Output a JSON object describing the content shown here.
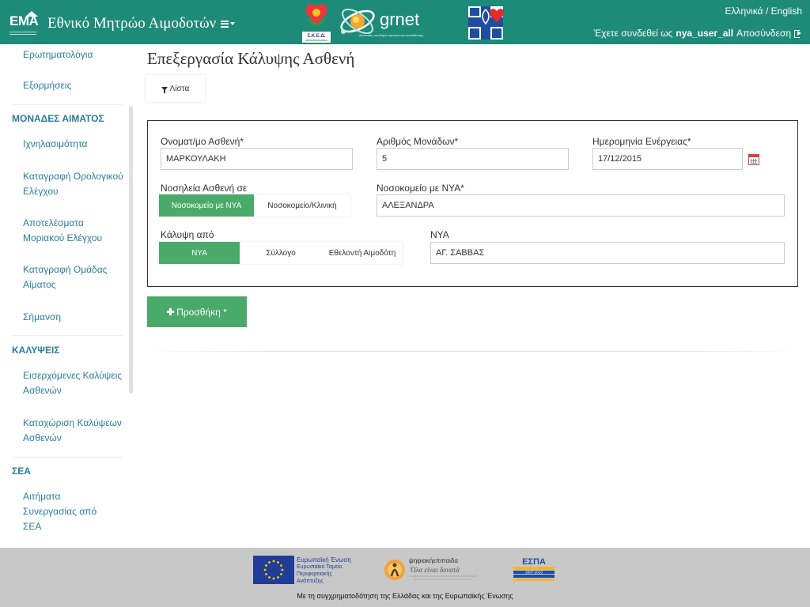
{
  "header": {
    "logo_text": "EMA",
    "title": "Εθνικό Μητρώο Αιμοδοτών",
    "sea_logo_text": "Σ.Κ.Ε.Δ.",
    "grnet_word": "grnet",
    "grnet_tagline": "Δικτυακές υποδομές έρευνας και εκπαίδευσης",
    "lang_greek": "Ελληνικά",
    "lang_sep": "/",
    "lang_english": "English",
    "user_prefix": "Έχετε συνδεθεί ως",
    "username": "nya_user_all",
    "logout_label": "Αποσύνδεση"
  },
  "sidebar": {
    "items": [
      {
        "label": "Ερωτηματολόγια"
      },
      {
        "label": "Εξορμήσεις"
      }
    ],
    "section_blood": "ΜΟΝΑΔΕΣ ΑΙΜΑΤΟΣ",
    "blood_items": [
      {
        "label": "Ιχνηλασιμότητα"
      },
      {
        "label": "Καταγραφή Ορολογικού Ελέγχου"
      },
      {
        "label": "Αποτελέσματα Μοριακού Ελέγχου"
      },
      {
        "label": "Καταγραφή Ομάδας Αίματος"
      },
      {
        "label": "Σήμανση"
      }
    ],
    "section_coverage": "ΚΑΛΥΨΕΙΣ",
    "coverage_items": [
      {
        "label": "Εισερχόμενες Καλύψεις Ασθενών"
      },
      {
        "label": "Καταχώριση Καλύψεων Ασθενών"
      }
    ],
    "section_sea": "ΣΕΑ",
    "sea_items": [
      {
        "label": "Αιτήματα Συνεργασίας από ΣΕΑ"
      }
    ]
  },
  "main": {
    "title": "Επεξεργασία Κάλυψης Ασθενή",
    "list_button": "Λίστα",
    "form": {
      "patient_name_label": "Ονοματ/μο Ασθενή*",
      "patient_name_value": "ΜΑΡΚΟΥΛΑΚΗ",
      "units_label": "Αριθμός Μονάδων*",
      "units_value": "5",
      "date_label": "Ημερομηνία Ενέργειας*",
      "date_value": "17/12/2015",
      "hospitalization_label": "Νοσηλεία Ασθενή σε",
      "hospitalization_options": [
        "Νοσοκομείο με ΝΥΑ",
        "Νοσοκομείο/Κλινική"
      ],
      "hospitalization_selected": 0,
      "hospital_label": "Νοσοκομείο με ΝΥΑ*",
      "hospital_value": "ΑΛΕΞΑΝΔΡΑ",
      "coverage_label": "Κάλυψη από",
      "coverage_options": [
        "ΝΥΑ",
        "Σύλλογο",
        "Εθελοντή Αιμοδότη"
      ],
      "coverage_selected": 0,
      "nya_label": "ΝΥΑ",
      "nya_value": "ΑΓ. ΣΑΒΒΑΣ"
    },
    "add_button": "Προσθήκη *"
  },
  "footer": {
    "eu_line1": "Ευρωπαϊκή Ένωση",
    "eu_line2": "Ευρωπαϊκό Ταμείο",
    "eu_line3": "Περιφερειακής",
    "eu_line4": "Ανάπτυξης",
    "digital_title": "ψηφιακήεπιπαιδα",
    "digital_slogan": "Όλα είναι δυνατά",
    "espa_label": "ΕΣΠΑ",
    "espa_years": "2007-2013",
    "cofunding_text": "Με τη συγχρηματοδότηση της Ελλάδας και της Ευρωπαϊκής Ένωσης"
  },
  "colors": {
    "header_bg": "#1e8b78",
    "accent_green": "#4aaa6a",
    "link_blue": "#2a7d9e",
    "footer_bg": "#c8c8c8"
  }
}
